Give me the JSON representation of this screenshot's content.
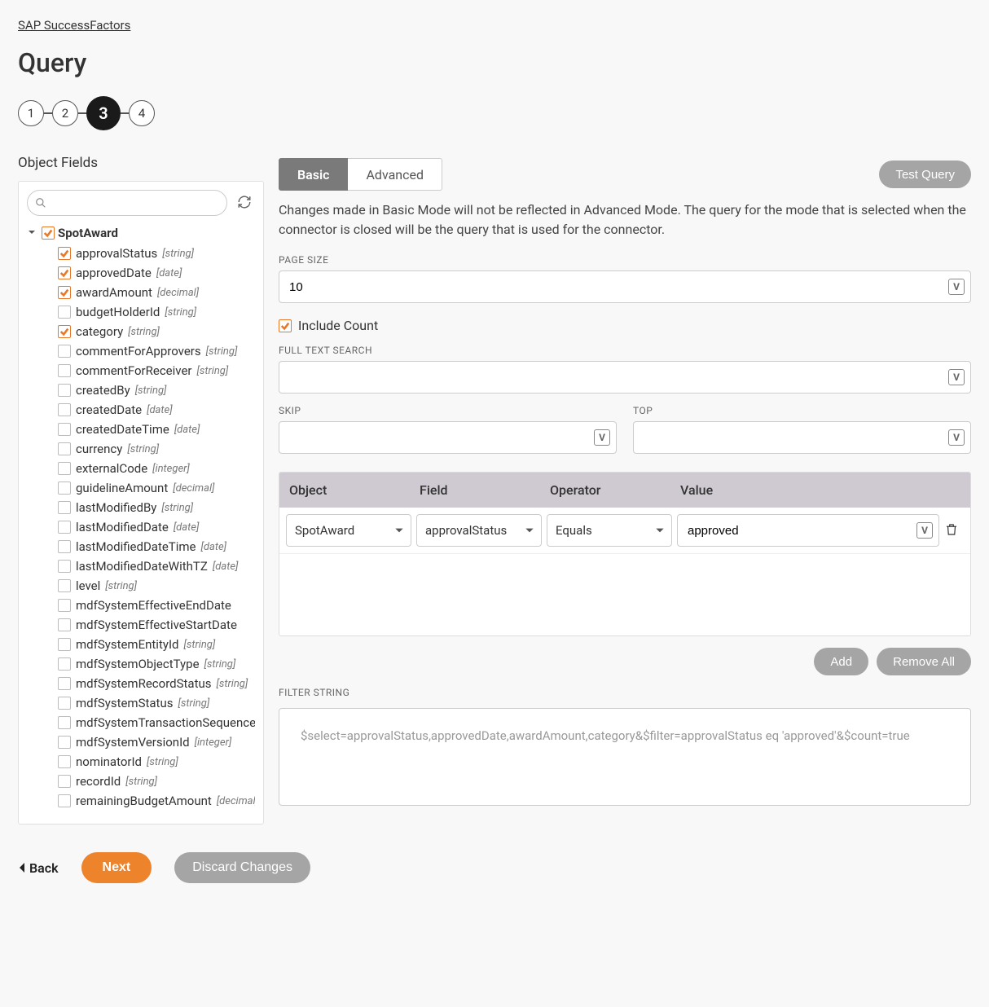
{
  "breadcrumb": "SAP SuccessFactors",
  "page_title": "Query",
  "stepper": {
    "steps": [
      "1",
      "2",
      "3",
      "4"
    ],
    "active_index": 2
  },
  "left": {
    "section_label": "Object Fields",
    "search_placeholder": "",
    "root": "SpotAward",
    "fields": [
      {
        "name": "approvalStatus",
        "type": "string",
        "checked": true
      },
      {
        "name": "approvedDate",
        "type": "date",
        "checked": true
      },
      {
        "name": "awardAmount",
        "type": "decimal",
        "checked": true
      },
      {
        "name": "budgetHolderId",
        "type": "string",
        "checked": false
      },
      {
        "name": "category",
        "type": "string",
        "checked": true
      },
      {
        "name": "commentForApprovers",
        "type": "string",
        "checked": false
      },
      {
        "name": "commentForReceiver",
        "type": "string",
        "checked": false
      },
      {
        "name": "createdBy",
        "type": "string",
        "checked": false
      },
      {
        "name": "createdDate",
        "type": "date",
        "checked": false
      },
      {
        "name": "createdDateTime",
        "type": "date",
        "checked": false
      },
      {
        "name": "currency",
        "type": "string",
        "checked": false
      },
      {
        "name": "externalCode",
        "type": "integer",
        "checked": false
      },
      {
        "name": "guidelineAmount",
        "type": "decimal",
        "checked": false
      },
      {
        "name": "lastModifiedBy",
        "type": "string",
        "checked": false
      },
      {
        "name": "lastModifiedDate",
        "type": "date",
        "checked": false
      },
      {
        "name": "lastModifiedDateTime",
        "type": "date",
        "checked": false
      },
      {
        "name": "lastModifiedDateWithTZ",
        "type": "date",
        "checked": false
      },
      {
        "name": "level",
        "type": "string",
        "checked": false
      },
      {
        "name": "mdfSystemEffectiveEndDate",
        "type": "",
        "checked": false
      },
      {
        "name": "mdfSystemEffectiveStartDate",
        "type": "",
        "checked": false
      },
      {
        "name": "mdfSystemEntityId",
        "type": "string",
        "checked": false
      },
      {
        "name": "mdfSystemObjectType",
        "type": "string",
        "checked": false
      },
      {
        "name": "mdfSystemRecordStatus",
        "type": "string",
        "checked": false
      },
      {
        "name": "mdfSystemStatus",
        "type": "string",
        "checked": false
      },
      {
        "name": "mdfSystemTransactionSequence",
        "type": "",
        "checked": false
      },
      {
        "name": "mdfSystemVersionId",
        "type": "integer",
        "checked": false
      },
      {
        "name": "nominatorId",
        "type": "string",
        "checked": false
      },
      {
        "name": "recordId",
        "type": "string",
        "checked": false
      },
      {
        "name": "remainingBudgetAmount",
        "type": "decimal",
        "checked": false
      }
    ]
  },
  "right": {
    "tabs": {
      "basic": "Basic",
      "advanced": "Advanced",
      "active": "basic"
    },
    "test_query": "Test Query",
    "mode_note": "Changes made in Basic Mode will not be reflected in Advanced Mode. The query for the mode that is selected when the connector is closed will be the query that is used for the connector.",
    "labels": {
      "page_size": "PAGE SIZE",
      "include_count": "Include Count",
      "full_text_search": "FULL TEXT SEARCH",
      "skip": "SKIP",
      "top": "TOP",
      "filter_string": "FILTER STRING"
    },
    "values": {
      "page_size": "10",
      "include_count_checked": true,
      "full_text_search": "",
      "skip": "",
      "top": ""
    },
    "filter_table": {
      "headers": {
        "object": "Object",
        "field": "Field",
        "operator": "Operator",
        "value": "Value"
      },
      "rows": [
        {
          "object": "SpotAward",
          "field": "approvalStatus",
          "operator": "Equals",
          "value": "approved"
        }
      ]
    },
    "actions": {
      "add": "Add",
      "remove_all": "Remove All"
    },
    "filter_string_value": "$select=approvalStatus,approvedDate,awardAmount,category&$filter=approvalStatus eq 'approved'&$count=true"
  },
  "footer": {
    "back": "Back",
    "next": "Next",
    "discard": "Discard Changes"
  },
  "badge_char": "V"
}
